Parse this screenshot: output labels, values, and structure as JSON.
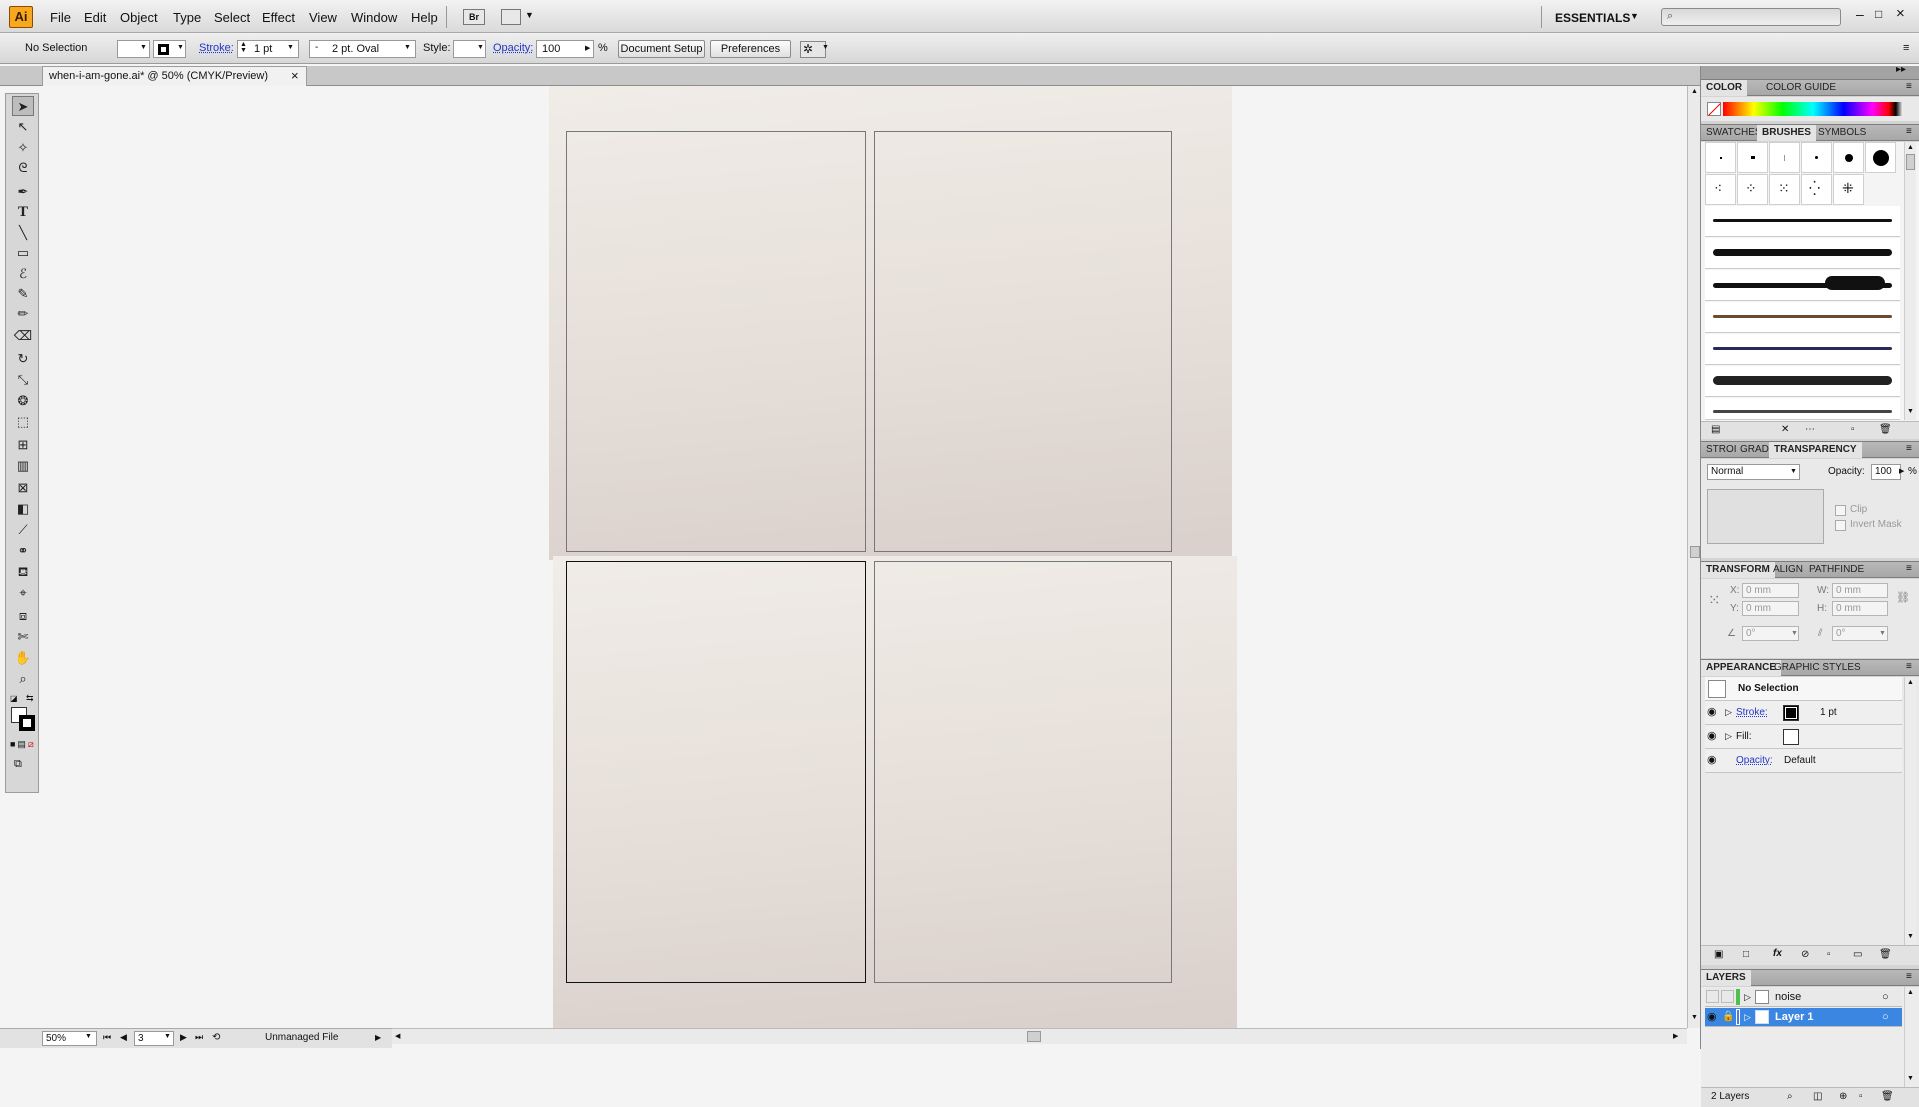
{
  "app": {
    "logo": "Ai"
  },
  "menu": [
    "File",
    "Edit",
    "Object",
    "Type",
    "Select",
    "Effect",
    "View",
    "Window",
    "Help"
  ],
  "bridge_label": "Br",
  "workspace": "ESSENTIALS",
  "control": {
    "selection": "No Selection",
    "stroke_label": "Stroke:",
    "stroke_value": "1 pt",
    "brush_value": "2 pt. Oval",
    "style_label": "Style:",
    "opacity_label": "Opacity:",
    "opacity_value": "100",
    "opacity_unit": "%",
    "document_setup": "Document Setup",
    "preferences": "Preferences"
  },
  "document_tab": {
    "title": "when-i-am-gone.ai* @ 50% (CMYK/Preview)",
    "close": "×"
  },
  "status": {
    "zoom": "50%",
    "artboard": "3",
    "info": "Unmanaged File"
  },
  "panels": {
    "color_tabs": [
      "COLOR",
      "COLOR GUIDE"
    ],
    "brush_tabs": [
      "SWATCHES",
      "BRUSHES",
      "SYMBOLS"
    ],
    "transparency_tabs": [
      "STROI",
      "GRAD",
      "TRANSPARENCY"
    ],
    "transparency": {
      "mode": "Normal",
      "opacity_label": "Opacity:",
      "opacity_value": "100",
      "unit": "%",
      "clip": "Clip",
      "invert_mask": "Invert Mask"
    },
    "transform_tabs": [
      "TRANSFORM",
      "ALIGN",
      "PATHFINDE"
    ],
    "transform": {
      "x_label": "X:",
      "x": "0 mm",
      "y_label": "Y:",
      "y": "0 mm",
      "w_label": "W:",
      "w": "0 mm",
      "h_label": "H:",
      "h": "0 mm",
      "angle": "0°",
      "shear": "0°"
    },
    "appearance_tabs": [
      "APPEARANCE",
      "GRAPHIC STYLES"
    ],
    "appearance": {
      "title": "No Selection",
      "stroke_label": "Stroke:",
      "stroke_value": "1 pt",
      "fill_label": "Fill:",
      "opacity_label": "Opacity:",
      "opacity_value": "Default"
    },
    "layers_title": "LAYERS",
    "layers": [
      {
        "name": "noise",
        "color": "#4cc24c",
        "selected": false
      },
      {
        "name": "Layer 1",
        "color": "#4a7be0",
        "selected": true
      }
    ],
    "layers_count": "2 Layers"
  },
  "colors": {
    "accent": "#3b86e0",
    "link": "#2036c8"
  }
}
